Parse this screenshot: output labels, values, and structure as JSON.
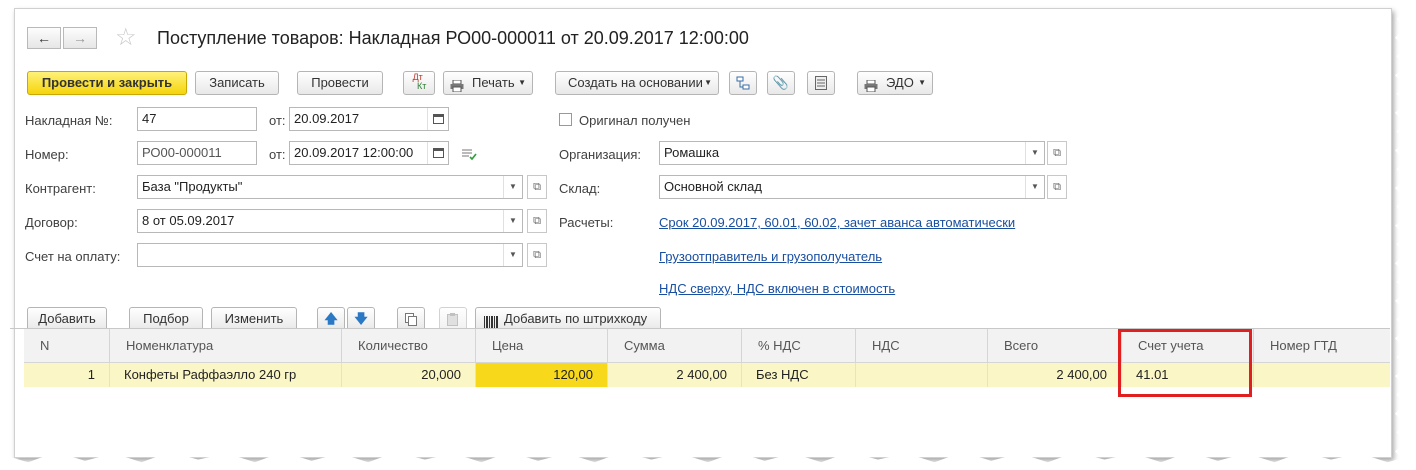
{
  "window": {
    "title": "Поступление товаров: Накладная РО00-000011 от 20.09.2017 12:00:00",
    "nav_back": "←",
    "nav_forward": "→",
    "favorite_star": "☆"
  },
  "toolbar": {
    "post_and_close": "Провести и закрыть",
    "save": "Записать",
    "post": "Провести",
    "dtkt_top": "Дт",
    "dtkt_bottom": "Кт",
    "print": "Печать",
    "create_based_on": "Создать на основании",
    "edo": "ЭДО"
  },
  "form": {
    "invoice_no_label": "Накладная №:",
    "invoice_no_value": "47",
    "from_label": "от:",
    "invoice_date": "20.09.2017",
    "number_label": "Номер:",
    "number_value": "РО00-000011",
    "doc_datetime": "20.09.2017 12:00:00",
    "original_received_label": "Оригинал получен",
    "organization_label": "Организация:",
    "organization_value": "Ромашка",
    "counterparty_label": "Контрагент:",
    "counterparty_value": "База \"Продукты\"",
    "warehouse_label": "Склад:",
    "warehouse_value": "Основной склад",
    "contract_label": "Договор:",
    "contract_value": "8 от 05.09.2017",
    "settlements_label": "Расчеты:",
    "settlements_link": "Срок 20.09.2017, 60.01, 60.02, зачет аванса автоматически",
    "payment_invoice_label": "Счет на оплату:",
    "payment_invoice_value": "",
    "shipper_link": "Грузоотправитель и грузополучатель",
    "vat_link": "НДС сверху, НДС включен в стоимость"
  },
  "table_toolbar": {
    "add": "Добавить",
    "pick": "Подбор",
    "edit": "Изменить",
    "add_by_barcode": "Добавить по штрихкоду"
  },
  "table": {
    "columns": [
      "N",
      "Номенклатура",
      "Количество",
      "Цена",
      "Сумма",
      "% НДС",
      "НДС",
      "Всего",
      "Счет учета",
      "Номер ГТД"
    ],
    "rows": [
      {
        "n": "1",
        "item": "Конфеты Раффаэлло 240 гр",
        "qty": "20,000",
        "price": "120,00",
        "sum": "2 400,00",
        "vat_rate": "Без НДС",
        "vat": "",
        "total": "2 400,00",
        "account": "41.01",
        "gtd": ""
      }
    ]
  },
  "colors": {
    "primary_button": "#f5d40a",
    "row_highlight": "#faf6c5",
    "selected_cell": "#f8d81a",
    "annotation_box": "#e02020",
    "link": "#1a4fa0"
  }
}
